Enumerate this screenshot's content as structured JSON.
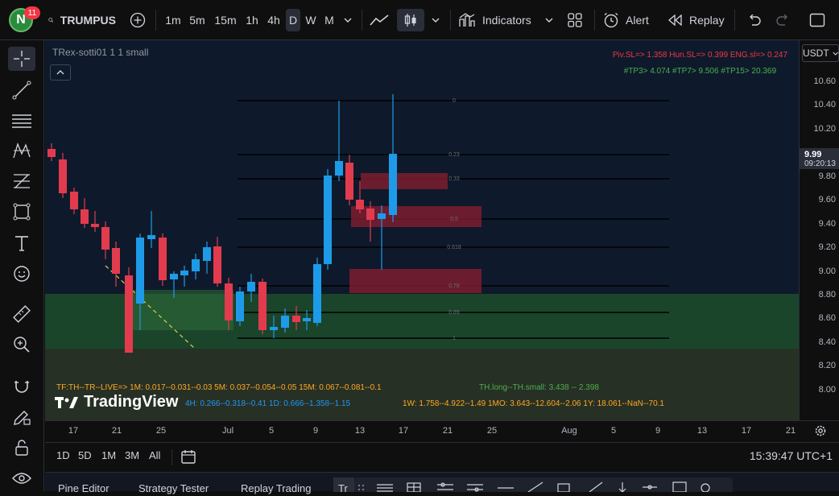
{
  "toolbar": {
    "avatar_letter": "N",
    "notifications": "11",
    "symbol": "TRUMPUS",
    "intervals": [
      "1m",
      "5m",
      "15m",
      "1h",
      "4h",
      "D",
      "W",
      "M"
    ],
    "selected_interval": "D",
    "indicators_label": "Indicators",
    "alert_label": "Alert",
    "replay_label": "Replay"
  },
  "chart": {
    "legend_title": "TRex-sotti01 1 1 small",
    "sl_line": "Piv.SL=> 1.358  Hun.SL=> 0.399  ENG.sl=> 0.247",
    "tp_line": "#TP3> 4.074  #TP7> 9.506  #TP15> 20.369",
    "tf_line1_a": "TF:TH--TR--LIVE=>  1M: 0.017--0.031--0.03     5M: 0.037--0.054--0.05     15M: 0.067--0.081--0.1",
    "tf_line1_b": "TH.long--TH.small: 3.438 -- 2.398",
    "tf_line2_a": "4H: 0.266--0.318--0.41     1D: 0.666--1.358--1.15",
    "tf_line2_b": "1W: 1.758--4.922--1.49     1MO: 3.643--12.604--2.06     1Y: 18.061--NaN--70.1",
    "watermark": "TradingView",
    "fib_labels": [
      "0",
      "0.23",
      "0.33",
      "0.5",
      "0.618",
      "0.78",
      "0.89",
      "1"
    ],
    "colors": {
      "up": "#1e9be8",
      "down": "#e23b4e",
      "background": "#0e1a2b",
      "zone": "#1d4d2b"
    }
  },
  "price_axis": {
    "currency": "USDT",
    "labels": [
      "10.60",
      "10.40",
      "10.20",
      "9.80",
      "9.60",
      "9.40",
      "9.20",
      "9.00",
      "8.80",
      "8.60",
      "8.40",
      "8.20",
      "8.00"
    ],
    "current_price": "9.99",
    "countdown": "09:20:13"
  },
  "time_axis": {
    "labels": [
      "17",
      "21",
      "25",
      "Jul",
      "5",
      "9",
      "13",
      "17",
      "21",
      "25",
      "Aug",
      "5",
      "9",
      "13",
      "17",
      "21"
    ]
  },
  "bottom_bar": {
    "ranges": [
      "1D",
      "5D",
      "1M",
      "3M",
      "All"
    ],
    "clock": "15:39:47 UTC+1"
  },
  "panel_tabs": [
    "Pine Editor",
    "Strategy Tester",
    "Replay Trading",
    "Tr"
  ]
}
